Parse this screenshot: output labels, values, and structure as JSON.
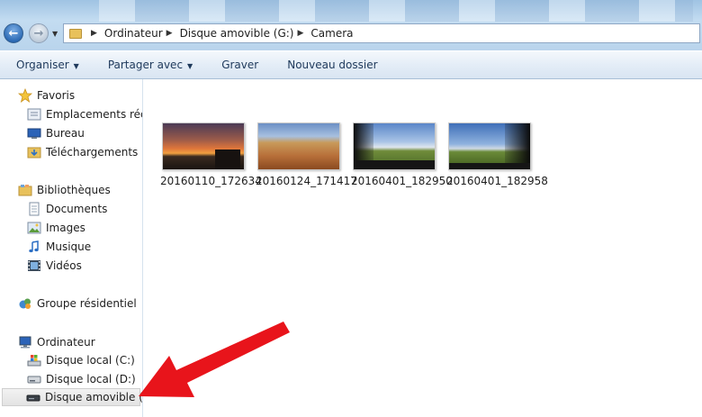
{
  "address": {
    "segments": [
      "Ordinateur",
      "Disque amovible (G:)",
      "Camera"
    ]
  },
  "toolbar": {
    "organize": "Organiser",
    "share": "Partager avec",
    "burn": "Graver",
    "new_folder": "Nouveau dossier"
  },
  "nav": {
    "favorites": {
      "label": "Favoris",
      "items": [
        "Emplacements récents",
        "Bureau",
        "Téléchargements"
      ]
    },
    "libraries": {
      "label": "Bibliothèques",
      "items": [
        "Documents",
        "Images",
        "Musique",
        "Vidéos"
      ]
    },
    "homegroup": "Groupe résidentiel",
    "computer": {
      "label": "Ordinateur",
      "items": [
        "Disque local (C:)",
        "Disque local (D:)",
        "Disque amovible (G:)"
      ]
    }
  },
  "files": [
    {
      "name": "20160110_172634"
    },
    {
      "name": "20160124_171417"
    },
    {
      "name": "20160401_182950"
    },
    {
      "name": "20160401_182958"
    }
  ],
  "colors": {
    "arrow": "#e8141b",
    "accent": "#1e395b"
  }
}
